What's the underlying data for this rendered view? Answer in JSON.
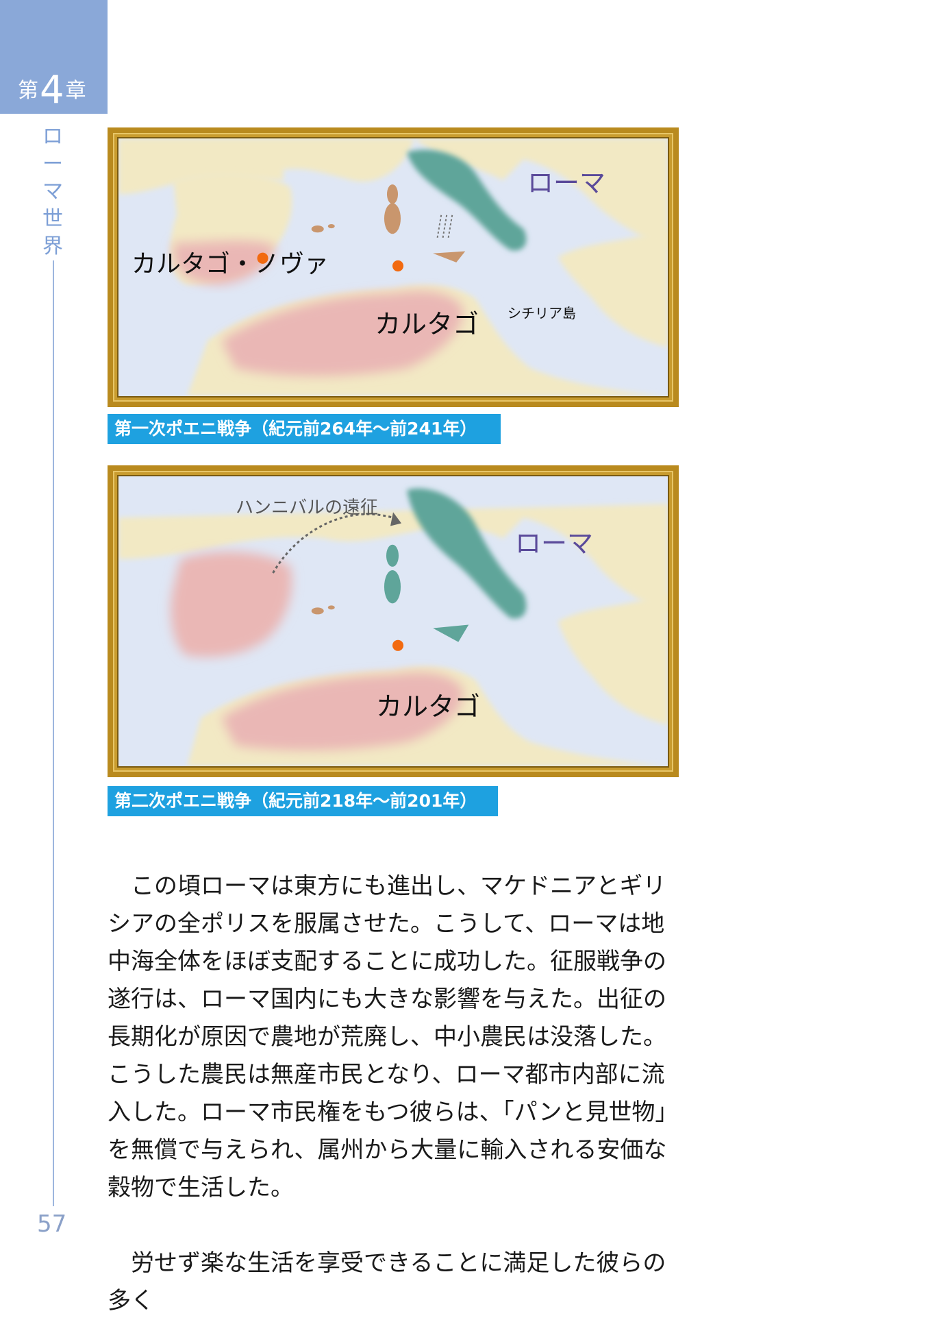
{
  "chapter": {
    "prefix": "第",
    "number": "4",
    "suffix": "章"
  },
  "section_title": "ローマ世界",
  "page_number": "57",
  "maps": [
    {
      "labels": {
        "rome": "ローマ",
        "new_carthage": "カルタゴ・ノヴァ",
        "carthage": "カルタゴ",
        "sicily": "シチリア島"
      },
      "caption": "第一次ポエニ戦争（紀元前264年～前241年）"
    },
    {
      "labels": {
        "hannibal": "ハンニバルの遠征",
        "rome": "ローマ",
        "carthage": "カルタゴ"
      },
      "caption": "第二次ポエニ戦争（紀元前218年～前201年）"
    }
  ],
  "colors": {
    "sea": "#dfe7f5",
    "land": "#f2e9c4",
    "carthage": "#eab7b5",
    "rome": "#5fa59a",
    "city_marker": "#f26a10",
    "frame_gold": "#c89b2e",
    "caption_blue": "#1ea1e0",
    "rome_label": "#5a4a9a"
  },
  "body": {
    "paragraphs": [
      "この頃ローマは東方にも進出し、マケドニアとギリシアの全ポリスを服属させた。こうして、ローマは地中海全体をほぼ支配することに成功した。征服戦争の遂行は、ローマ国内にも大きな影響を与えた。出征の長期化が原因で農地が荒廃し、中小農民は没落した。こうした農民は無産市民となり、ローマ都市内部に流入した。ローマ市民権をもつ彼らは、「パンと見世物」を無償で与えられ、属州から大量に輸入される安価な穀物で生活した。",
      "労せず楽な生活を享受できることに満足した彼らの多く"
    ]
  }
}
